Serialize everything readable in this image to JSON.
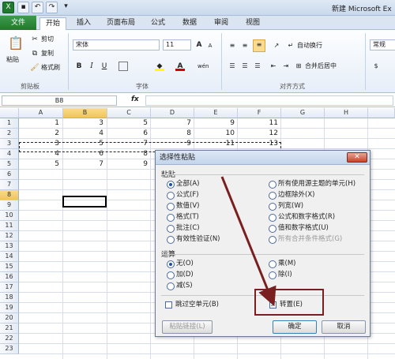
{
  "window": {
    "title": "新建 Microsoft Ex"
  },
  "quick_access": {
    "save_icon": "save-icon",
    "undo_icon": "undo-icon",
    "redo_icon": "redo-icon"
  },
  "tabs": [
    {
      "label": "文件"
    },
    {
      "label": "开始"
    },
    {
      "label": "插入"
    },
    {
      "label": "页面布局"
    },
    {
      "label": "公式"
    },
    {
      "label": "数据"
    },
    {
      "label": "审阅"
    },
    {
      "label": "视图"
    }
  ],
  "ribbon": {
    "clipboard": {
      "paste": "粘贴",
      "cut": "剪切",
      "copy": "复制",
      "format_painter": "格式刷",
      "group": "剪贴板"
    },
    "font": {
      "name": "宋体",
      "size": "11",
      "bold": "B",
      "italic": "I",
      "underline": "U",
      "grow": "A",
      "shrink": "A",
      "group": "字体",
      "font_color": "#cc0000",
      "fill_color": "#ffff00"
    },
    "alignment": {
      "wrap": "自动换行",
      "merge": "合并后居中",
      "group": "对齐方式"
    },
    "number": {
      "format": "常规"
    }
  },
  "formula_bar": {
    "name_box": "B8",
    "fx": "fx",
    "value": ""
  },
  "sheet": {
    "columns": [
      "A",
      "B",
      "C",
      "D",
      "E",
      "F",
      "G",
      "H"
    ],
    "rows": [
      "1",
      "2",
      "3",
      "4",
      "5",
      "6",
      "7",
      "8",
      "9",
      "10",
      "11",
      "12",
      "13",
      "14",
      "15",
      "16",
      "17",
      "18",
      "19",
      "20",
      "21",
      "22",
      "23"
    ],
    "cells": [
      [
        "1",
        "3",
        "5",
        "7",
        "9",
        "11"
      ],
      [
        "2",
        "4",
        "6",
        "8",
        "10",
        "12"
      ],
      [
        "3",
        "5",
        "7",
        "9",
        "11",
        "13"
      ],
      [
        "4",
        "6",
        "8",
        "",
        "",
        ""
      ],
      [
        "5",
        "7",
        "9",
        "",
        "",
        ""
      ]
    ],
    "active_cell": "B8"
  },
  "dialog": {
    "title": "选择性粘贴",
    "close": "✕",
    "paste_section": "粘贴",
    "paste_left": [
      "全部(A)",
      "公式(F)",
      "数值(V)",
      "格式(T)",
      "批注(C)",
      "有效性验证(N)"
    ],
    "paste_right": [
      "所有使用源主题的单元(H)",
      "边框除外(X)",
      "列宽(W)",
      "公式和数字格式(R)",
      "值和数字格式(U)",
      "所有合并条件格式(G)"
    ],
    "operation_section": "运算",
    "operation_left": [
      "无(O)",
      "加(D)",
      "减(S)"
    ],
    "operation_right": [
      "乘(M)",
      "除(I)"
    ],
    "skip_blanks": "跳过空单元(B)",
    "transpose": "转置(E)",
    "transpose_checked": "✓",
    "paste_link": "粘贴链接(L)",
    "ok": "确定",
    "cancel": "取消"
  },
  "colors": {
    "annotation": "#7a1f1f",
    "accent_green": "#1f7a2e",
    "selected_header": "#f2c45a"
  }
}
